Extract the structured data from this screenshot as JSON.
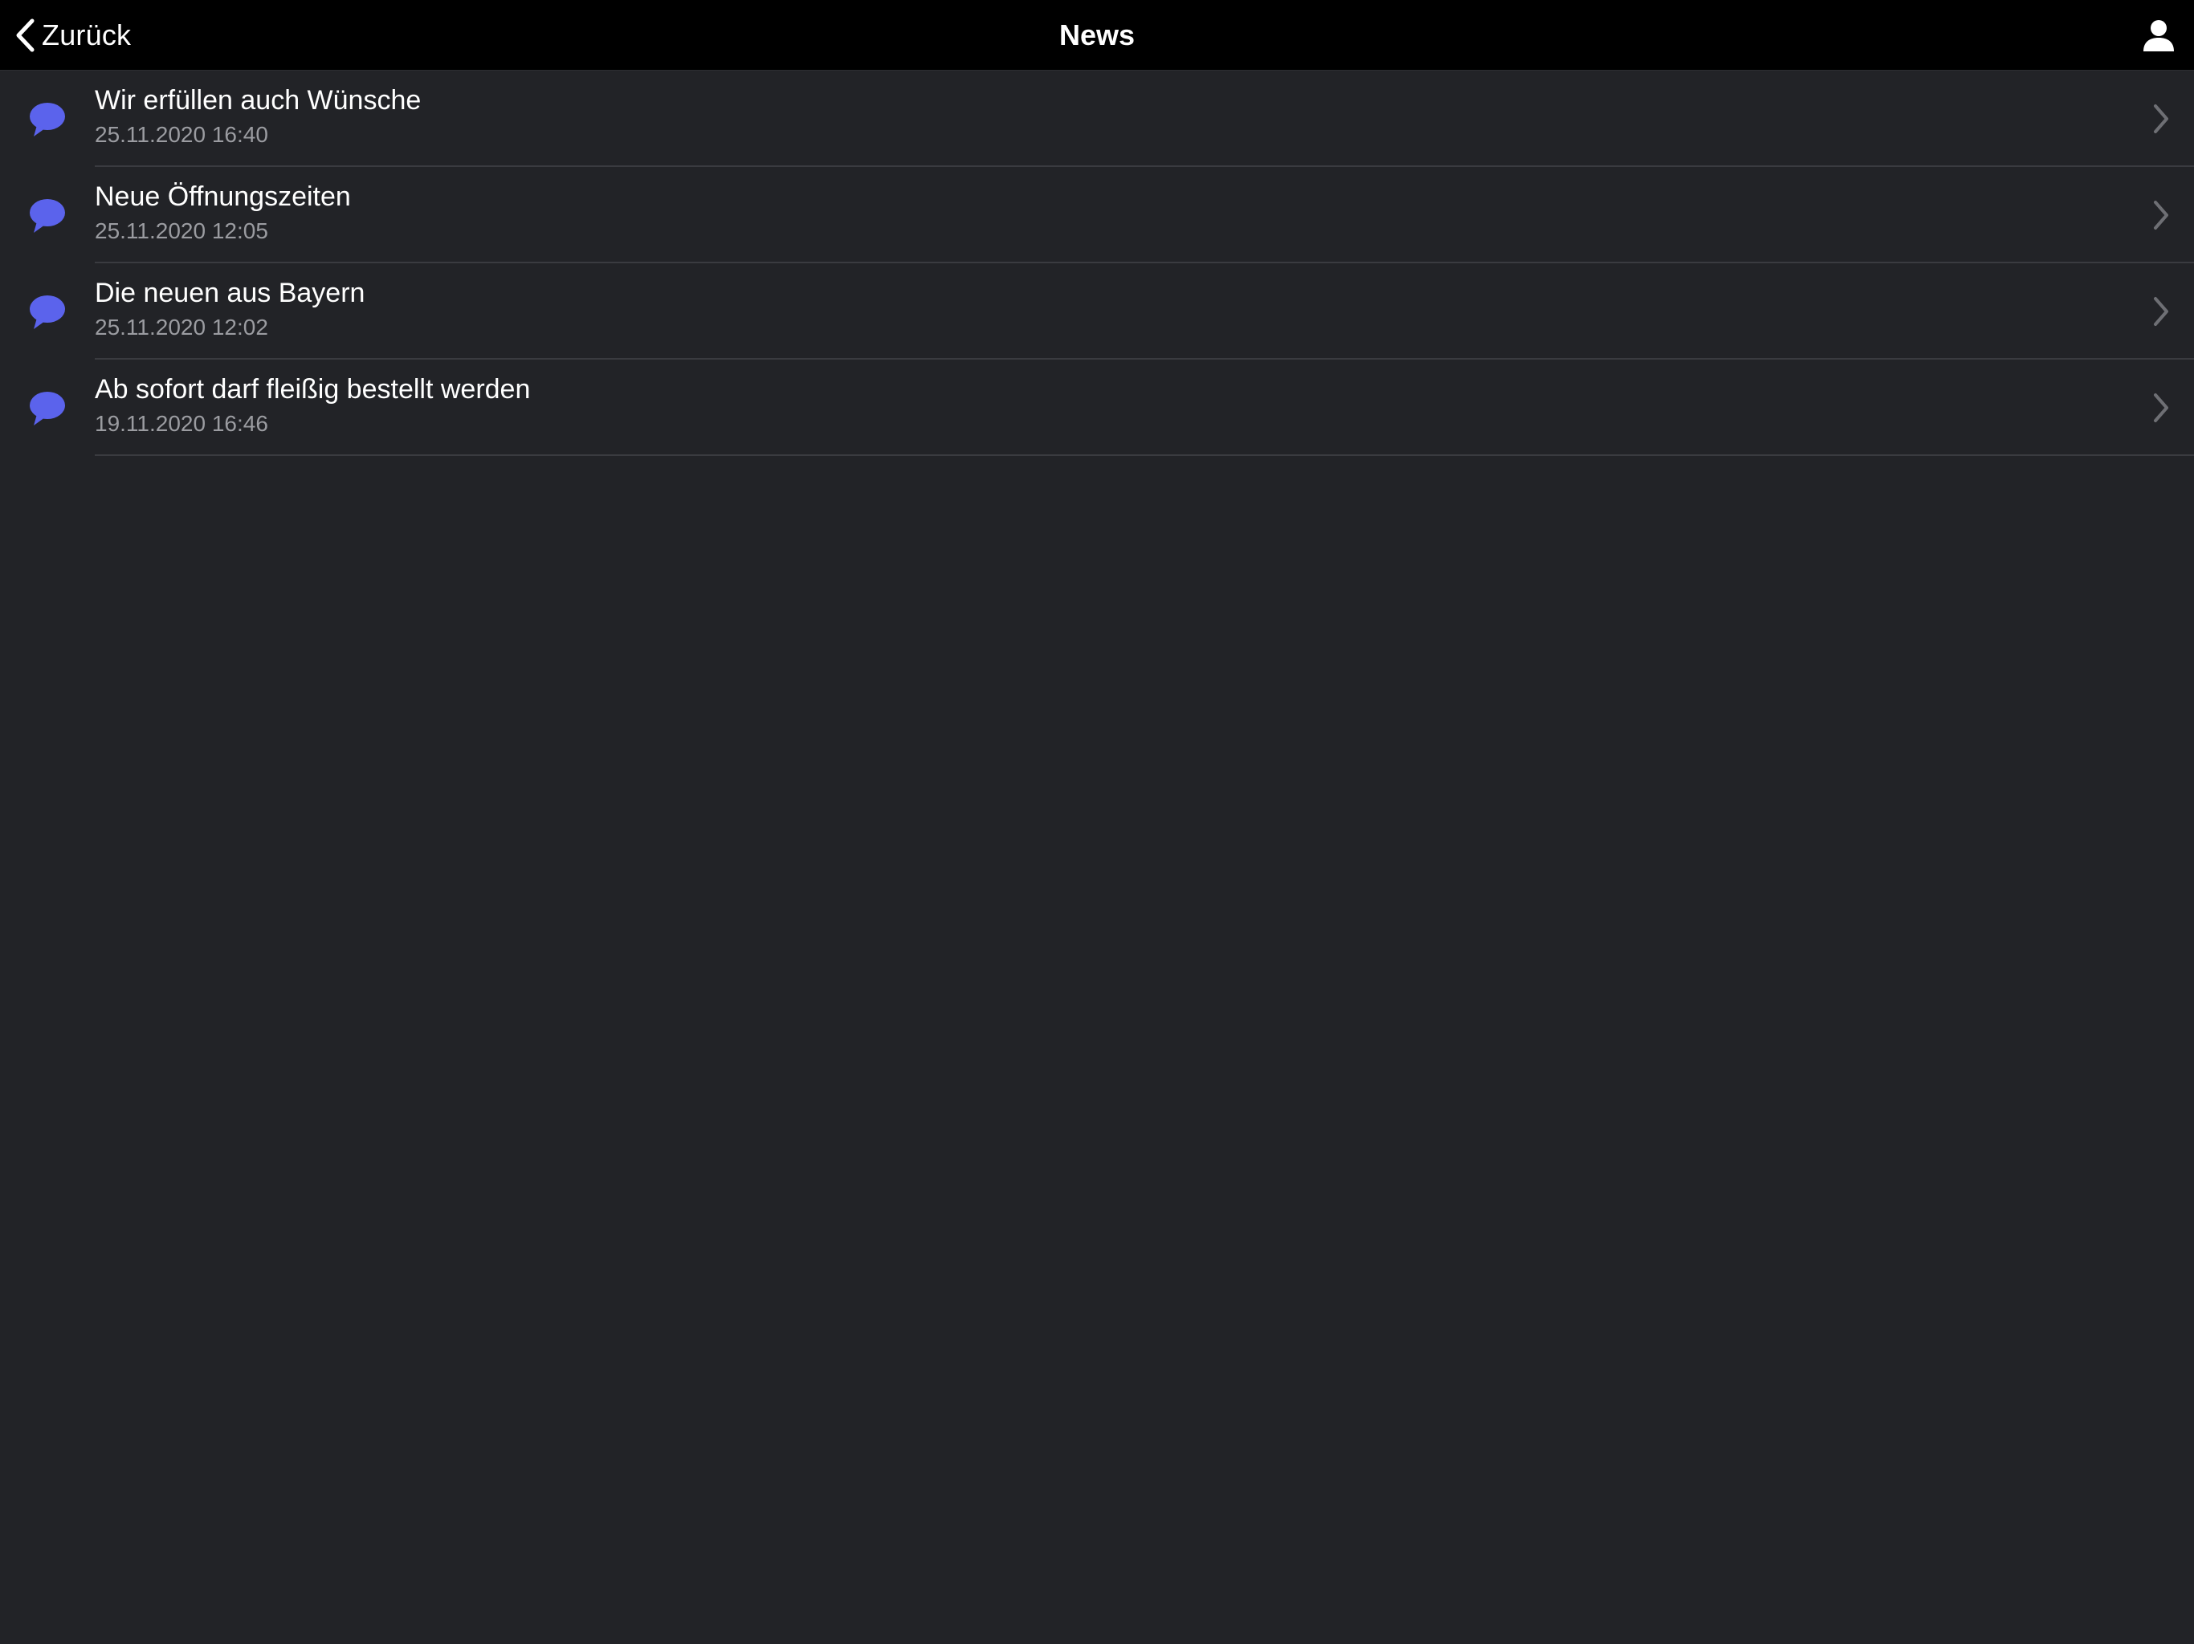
{
  "navbar": {
    "back_label": "Zurück",
    "title": "News",
    "profile_icon": "person-icon"
  },
  "colors": {
    "accent": "#5b63ec",
    "background": "#222327",
    "navbar": "#000000",
    "subtitle": "#9b9ca1"
  },
  "news": {
    "items": [
      {
        "title": "Wir erfüllen auch Wünsche",
        "date": "25.11.2020 16:40",
        "icon": "speech-bubble-icon"
      },
      {
        "title": "Neue Öffnungszeiten",
        "date": "25.11.2020 12:05",
        "icon": "speech-bubble-icon"
      },
      {
        "title": "Die neuen aus Bayern",
        "date": "25.11.2020 12:02",
        "icon": "speech-bubble-icon"
      },
      {
        "title": "Ab sofort darf fleißig bestellt werden",
        "date": "19.11.2020 16:46",
        "icon": "speech-bubble-icon"
      }
    ]
  }
}
